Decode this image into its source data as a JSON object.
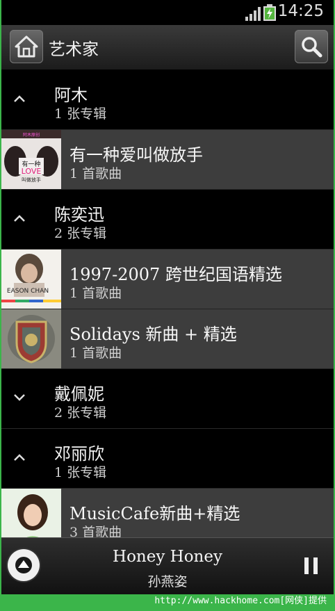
{
  "status": {
    "time": "14:25"
  },
  "header": {
    "title": "艺术家"
  },
  "artists": [
    {
      "name": "阿木",
      "albums": "1 张专辑",
      "expanded": true,
      "album_list": [
        {
          "title": "有一种爱叫做放手",
          "songs": "1 首歌曲",
          "cover_text": "有一种 LOVE 叫做放手",
          "cover_top": "阿木原创"
        }
      ]
    },
    {
      "name": "陈奕迅",
      "albums": "2 张专辑",
      "expanded": true,
      "album_list": [
        {
          "title": "1997-2007 跨世纪国语精选",
          "songs": "1 首歌曲",
          "cover_text": "EASON CHAN"
        },
        {
          "title": "Solidays 新曲 + 精选",
          "songs": "1 首歌曲"
        }
      ]
    },
    {
      "name": "戴佩妮",
      "albums": "2 张专辑",
      "expanded": false
    },
    {
      "name": "邓丽欣",
      "albums": "1 张专辑",
      "expanded": true,
      "album_list": [
        {
          "title": "MusicCafe新曲+精选",
          "songs": "3 首歌曲"
        }
      ]
    }
  ],
  "now_playing": {
    "song": "Honey Honey",
    "artist": "孙燕姿"
  },
  "footer": {
    "text": "http://www.hackhome.com[网侠]提供"
  }
}
